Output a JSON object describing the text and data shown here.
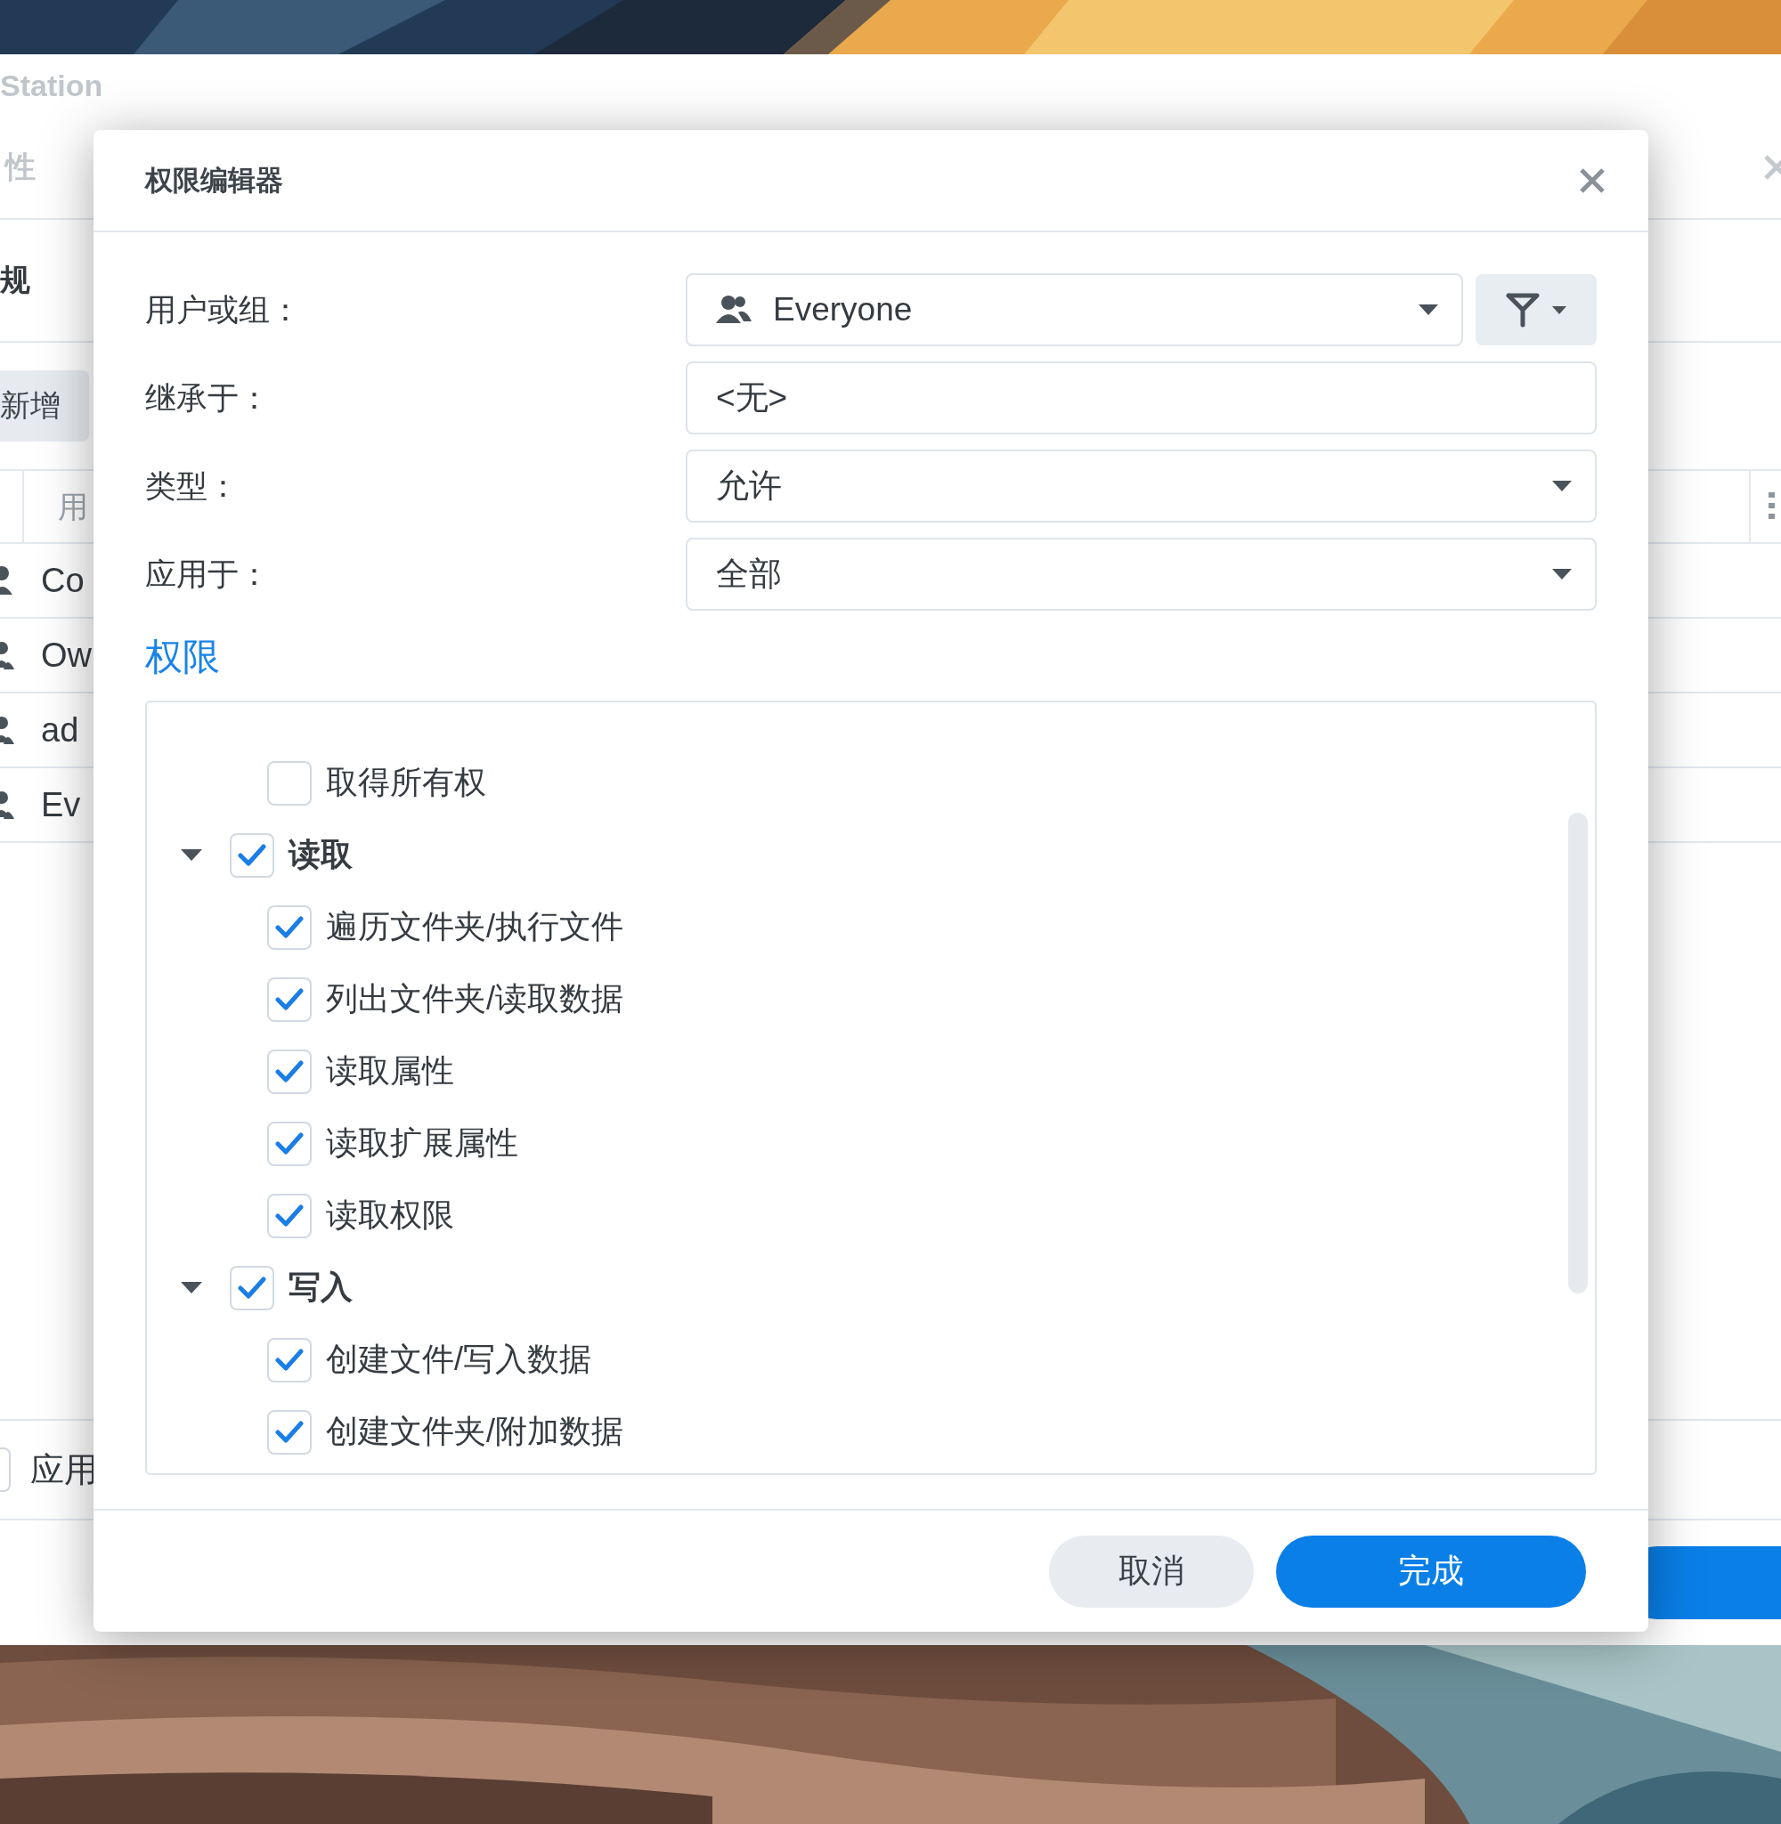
{
  "background_window": {
    "title": "Station",
    "subtitle": "性",
    "tab": "规",
    "add_button": "新增",
    "table": {
      "column_1": "用",
      "rows": [
        {
          "name": "Co",
          "kind": "user"
        },
        {
          "name": "Ow",
          "kind": "group"
        },
        {
          "name": "ad",
          "kind": "group"
        },
        {
          "name": "Ev",
          "kind": "group"
        }
      ]
    },
    "apply_checkbox": {
      "label": "应用",
      "checked": false
    }
  },
  "dialog": {
    "title": "权限编辑器",
    "fields": [
      {
        "label": "用户或组：",
        "value": "Everyone",
        "kind": "user-select"
      },
      {
        "label": "继承于：",
        "value": "<无>",
        "kind": "text"
      },
      {
        "label": "类型：",
        "value": "允许",
        "kind": "select"
      },
      {
        "label": "应用于：",
        "value": "全部",
        "kind": "select"
      }
    ],
    "section_title": "权限",
    "permissions": [
      {
        "children": [
          {
            "label": "取得所有权",
            "checked": false
          }
        ]
      },
      {
        "label": "读取",
        "checked": true,
        "expanded": true,
        "children": [
          {
            "label": "遍历文件夹/执行文件",
            "checked": true
          },
          {
            "label": "列出文件夹/读取数据",
            "checked": true
          },
          {
            "label": "读取属性",
            "checked": true
          },
          {
            "label": "读取扩展属性",
            "checked": true
          },
          {
            "label": "读取权限",
            "checked": true
          }
        ]
      },
      {
        "label": "写入",
        "checked": true,
        "expanded": true,
        "children": [
          {
            "label": "创建文件/写入数据",
            "checked": true
          },
          {
            "label": "创建文件夹/附加数据",
            "checked": true
          }
        ]
      }
    ],
    "buttons": [
      {
        "label": "取消",
        "kind": "secondary"
      },
      {
        "label": "完成",
        "kind": "primary"
      }
    ]
  }
}
